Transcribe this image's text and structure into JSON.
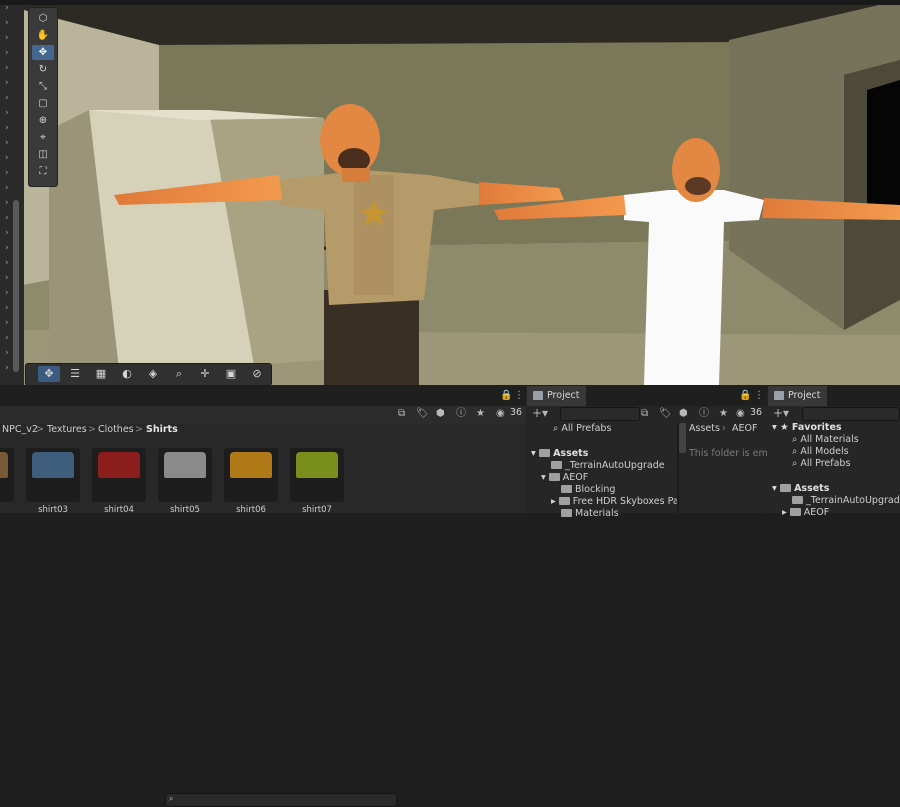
{
  "toolbar": {
    "tools": [
      "view-tool-icon",
      "hand-tool-icon",
      "move-tool-icon",
      "rotate-tool-icon",
      "scale-tool-icon",
      "rect-tool-icon",
      "transform-tool-icon",
      "custom-tool-icon",
      "custom-tool-2-icon",
      "custom-tool-3-icon"
    ],
    "active_tool": "move-tool-icon"
  },
  "scene_overlay": {
    "tools": [
      "move-icon",
      "align-icon",
      "grid-icon",
      "snap-icon",
      "layers-icon",
      "zoom-icon",
      "pivot-icon",
      "camera-icon",
      "navigate-icon"
    ]
  },
  "left_panel": {
    "search_placeholder": "",
    "count": "36",
    "breadcrumb": [
      "NPC_v2",
      "Textures",
      "Clothes",
      "Shirts"
    ],
    "breadcrumb_sep": ">",
    "assets": [
      {
        "label": "",
        "color": "#7a5a35"
      },
      {
        "label": "shirt03",
        "color": "#3f5d7c"
      },
      {
        "label": "shirt04",
        "color": "#8b1d1d"
      },
      {
        "label": "shirt05",
        "color": "#8a8a8a"
      },
      {
        "label": "shirt06",
        "color": "#b07a19"
      },
      {
        "label": "shirt07",
        "color": "#7a8f1b"
      }
    ]
  },
  "project_panel_1": {
    "tab_label": "Project",
    "count": "36",
    "tree_top": "All Prefabs",
    "assets_root": "Assets",
    "tree": [
      "_TerrainAutoUpgrade",
      "AEOF",
      "Blocking",
      "Free HDR Skyboxes Pa",
      "Materials"
    ],
    "breadcrumb": [
      "Assets",
      "AEOF"
    ],
    "empty_message": "This folder is emp"
  },
  "project_panel_2": {
    "tab_label": "Project",
    "favorites_label": "Favorites",
    "favorites": [
      "All Materials",
      "All Models",
      "All Prefabs"
    ],
    "assets_root": "Assets",
    "tree": [
      "_TerrainAutoUpgrade",
      "AEOF"
    ]
  }
}
